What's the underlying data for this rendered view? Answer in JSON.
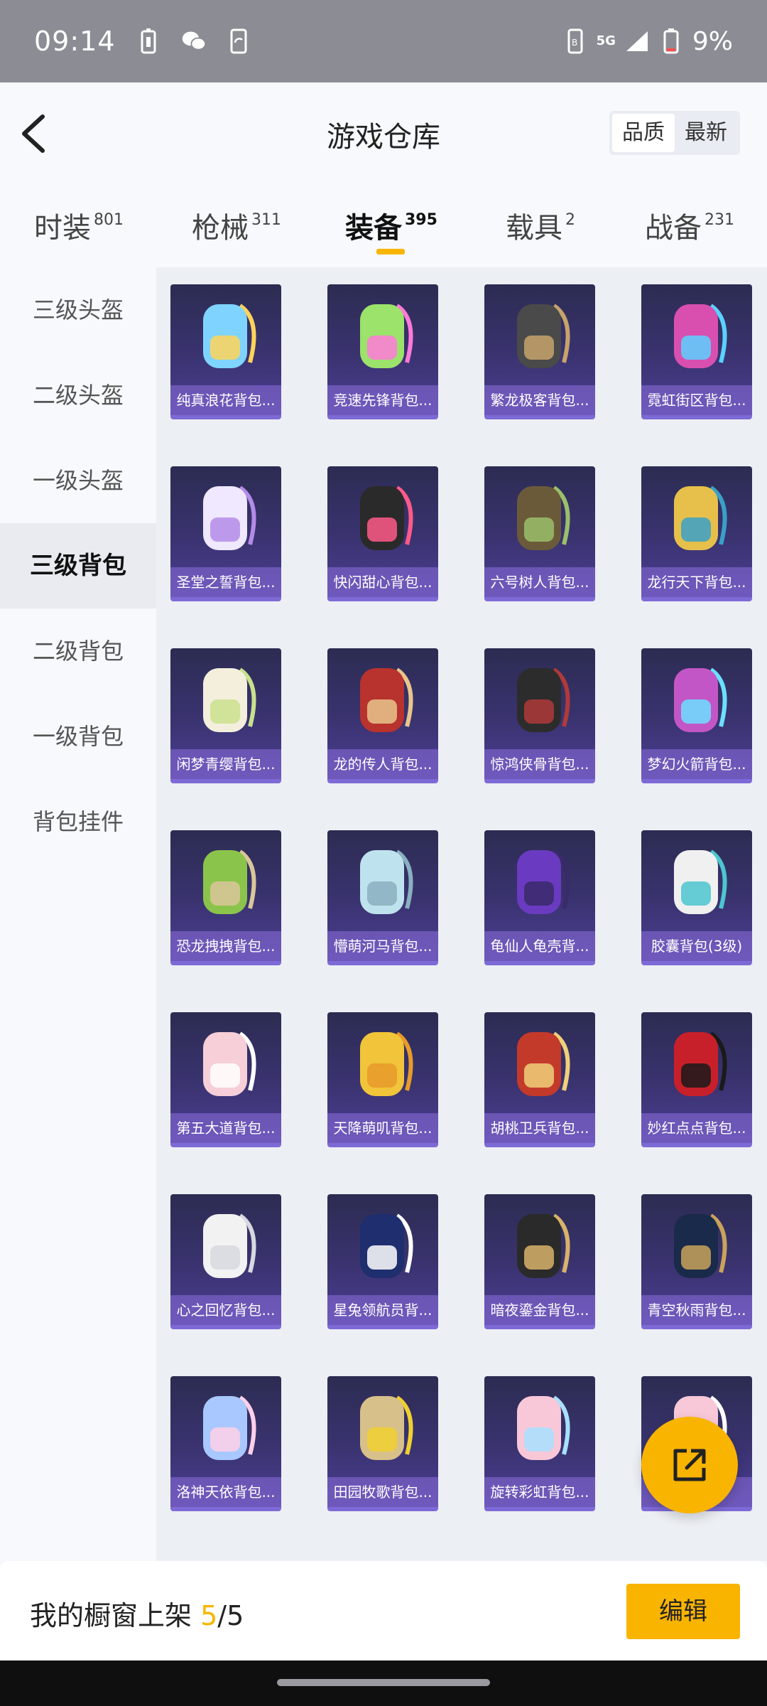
{
  "status_bar": {
    "time": "09:14",
    "network": "5G",
    "battery": "9%"
  },
  "header": {
    "title": "游戏仓库",
    "sort_options": [
      "品质",
      "最新"
    ],
    "sort_active": "品质"
  },
  "tabs": [
    {
      "label": "时装",
      "count": "801"
    },
    {
      "label": "枪械",
      "count": "311"
    },
    {
      "label": "装备",
      "count": "395",
      "active": true
    },
    {
      "label": "载具",
      "count": "2"
    },
    {
      "label": "战备",
      "count": "231"
    }
  ],
  "sidebar": {
    "items": [
      "三级头盔",
      "二级头盔",
      "一级头盔",
      "三级背包",
      "二级背包",
      "一级背包",
      "背包挂件"
    ],
    "active": "三级背包"
  },
  "items": [
    {
      "name": "纯真浪花背包..."
    },
    {
      "name": "竞速先锋背包..."
    },
    {
      "name": "繁龙极客背包..."
    },
    {
      "name": "霓虹街区背包..."
    },
    {
      "name": "圣堂之誓背包..."
    },
    {
      "name": "快闪甜心背包..."
    },
    {
      "name": "六号树人背包..."
    },
    {
      "name": "龙行天下背包..."
    },
    {
      "name": "闲梦青缨背包..."
    },
    {
      "name": "龙的传人背包..."
    },
    {
      "name": "惊鸿侠骨背包..."
    },
    {
      "name": "梦幻火箭背包..."
    },
    {
      "name": "恐龙拽拽背包..."
    },
    {
      "name": "懵萌河马背包..."
    },
    {
      "name": "龟仙人龟壳背..."
    },
    {
      "name": "胶囊背包(3级)"
    },
    {
      "name": "第五大道背包..."
    },
    {
      "name": "天降萌叽背包..."
    },
    {
      "name": "胡桃卫兵背包..."
    },
    {
      "name": "妙红点点背包..."
    },
    {
      "name": "心之回忆背包..."
    },
    {
      "name": "星兔领航员背..."
    },
    {
      "name": "暗夜鎏金背包..."
    },
    {
      "name": "青空秋雨背包..."
    },
    {
      "name": "洛神天依背包..."
    },
    {
      "name": "田园牧歌背包..."
    },
    {
      "name": "旋转彩虹背包..."
    },
    {
      "name": "..."
    }
  ],
  "bottom_bar": {
    "shelf_label": "我的橱窗上架",
    "shelf_count": "5",
    "shelf_total": "/5",
    "edit_label": "编辑"
  },
  "colors": {
    "accent": "#f9b400",
    "card_bg": "#3a3370",
    "card_label_bg": "#8c6edc"
  }
}
